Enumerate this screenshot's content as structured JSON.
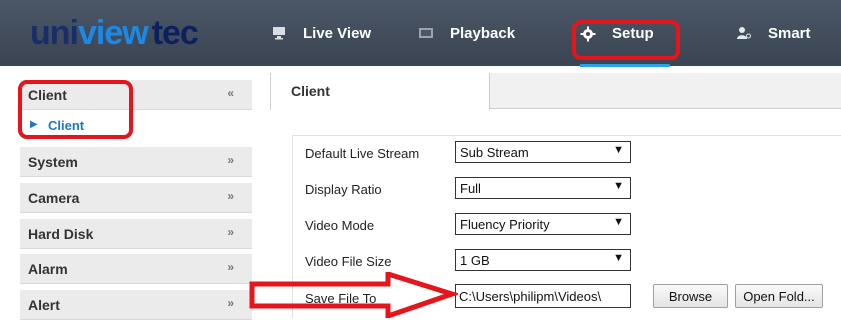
{
  "brand": {
    "logo_uni": "uni",
    "logo_view": "view",
    "logo_tec": "tec"
  },
  "nav": [
    {
      "label": "Live View",
      "icon": "monitor-icon"
    },
    {
      "label": "Playback",
      "icon": "film-icon"
    },
    {
      "label": "Setup",
      "icon": "gear-icon",
      "active": true
    },
    {
      "label": "Smart",
      "icon": "person-search-icon"
    }
  ],
  "sidebar": {
    "sections": [
      {
        "label": "Client",
        "expanded": true,
        "chevron": "«"
      },
      {
        "label": "System",
        "chevron": "»"
      },
      {
        "label": "Camera",
        "chevron": "»"
      },
      {
        "label": "Hard Disk",
        "chevron": "»"
      },
      {
        "label": "Alarm",
        "chevron": "»"
      },
      {
        "label": "Alert",
        "chevron": "»"
      }
    ],
    "sub_items": [
      {
        "label": "Client",
        "selected": true
      }
    ]
  },
  "main": {
    "tab": "Client",
    "rows": [
      {
        "label": "Default Live Stream",
        "value": "Sub Stream"
      },
      {
        "label": "Display Ratio",
        "value": "Full"
      },
      {
        "label": "Video Mode",
        "value": "Fluency Priority"
      },
      {
        "label": "Video File Size",
        "value": "1 GB"
      },
      {
        "label": "Save File To",
        "value": "C:\\Users\\philipm\\Videos\\"
      }
    ],
    "browse_label": "Browse",
    "open_folder_label": "Open Fold..."
  },
  "colors": {
    "highlight": "#e5151c",
    "accent": "#2aa4e8",
    "topbar": "#434e5d"
  }
}
